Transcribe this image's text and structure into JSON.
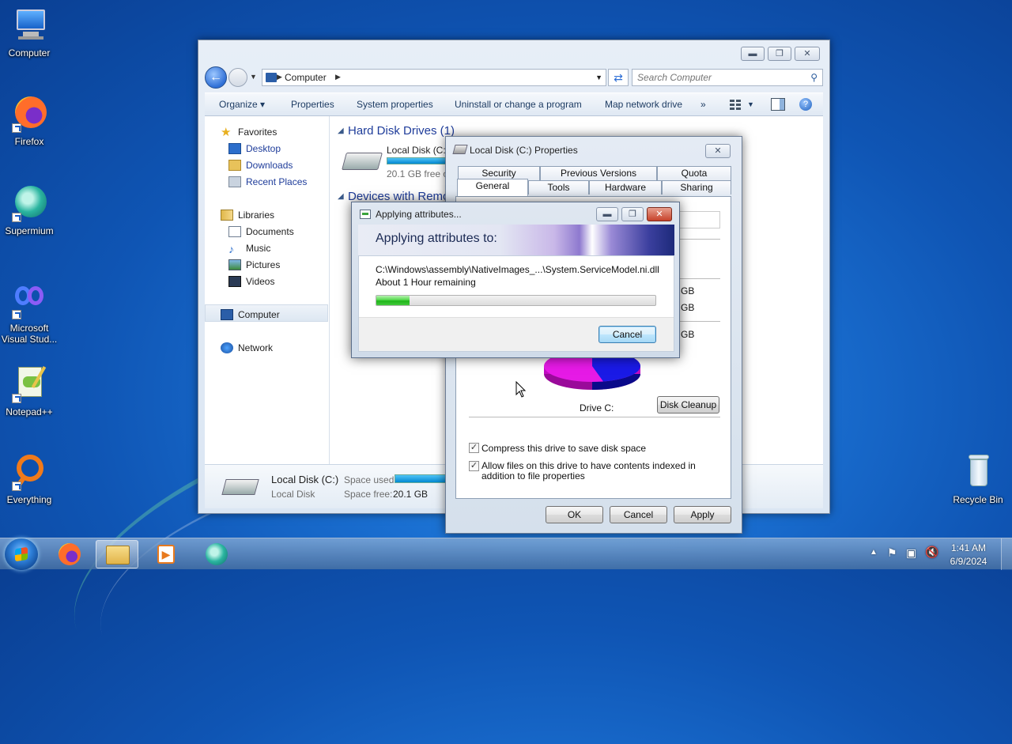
{
  "desktop": {
    "icons": [
      {
        "label": "Computer"
      },
      {
        "label": "Firefox"
      },
      {
        "label": "Supermium"
      },
      {
        "label": "Microsoft Visual Stud..."
      },
      {
        "label": "Notepad++"
      },
      {
        "label": "Everything"
      },
      {
        "label": "Recycle Bin"
      }
    ]
  },
  "explorer": {
    "breadcrumb": "Computer",
    "search_placeholder": "Search Computer",
    "toolbar": {
      "organize": "Organize",
      "properties": "Properties",
      "system_properties": "System properties",
      "uninstall": "Uninstall or change a program",
      "map_drive": "Map network drive",
      "more": "»"
    },
    "nav": {
      "favorites": "Favorites",
      "desktop": "Desktop",
      "downloads": "Downloads",
      "recent": "Recent Places",
      "libraries": "Libraries",
      "documents": "Documents",
      "music": "Music",
      "pictures": "Pictures",
      "videos": "Videos",
      "computer": "Computer",
      "network": "Network"
    },
    "content": {
      "hdd_header": "Hard Disk Drives (1)",
      "drive_name": "Local Disk (C:)",
      "drive_free": "20.1 GB free of",
      "removable_header": "Devices with Remo"
    },
    "details": {
      "name": "Local Disk (C:)",
      "type": "Local Disk",
      "used_label": "Space used:",
      "free_label": "Space free:",
      "free_value": "20.1 GB"
    }
  },
  "properties": {
    "title": "Local Disk (C:) Properties",
    "tabs_row1": [
      "Security",
      "Previous Versions",
      "Quota"
    ],
    "tabs_row2": [
      "General",
      "Tools",
      "Hardware",
      "Sharing"
    ],
    "gb_labels": [
      "GB",
      "GB",
      "GB"
    ],
    "drive_label": "Drive C:",
    "disk_cleanup": "Disk Cleanup",
    "compress_label": "Compress this drive to save disk space",
    "index_label": "Allow files on this drive to have contents indexed in addition to file properties",
    "compress_checked": true,
    "index_checked": true,
    "ok": "OK",
    "cancel": "Cancel",
    "apply": "Apply",
    "pie_colors": {
      "used": "#1a1ae6",
      "free": "#e61ae6"
    }
  },
  "applying": {
    "title": "Applying attributes...",
    "heading": "Applying attributes to:",
    "file": "C:\\Windows\\assembly\\NativeImages_...\\System.ServiceModel.ni.dll",
    "remaining": "About 1 Hour remaining",
    "progress": 0.12,
    "cancel": "Cancel"
  },
  "tray": {
    "time": "1:41 AM",
    "date": "6/9/2024"
  }
}
